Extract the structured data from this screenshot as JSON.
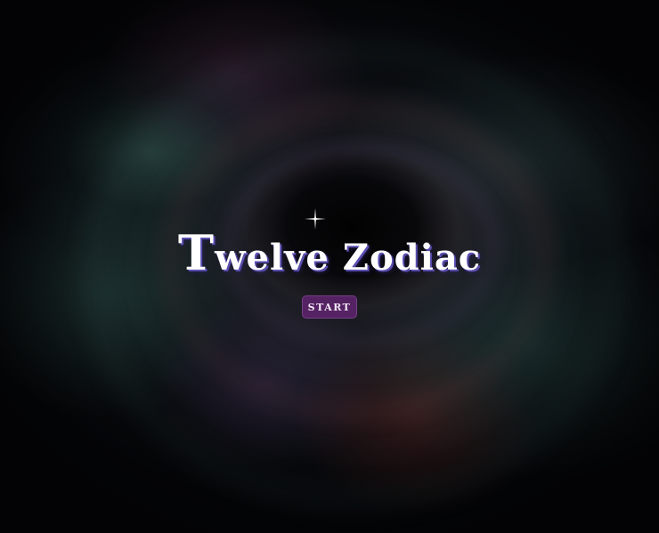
{
  "title": {
    "first_letter": "T",
    "rest": "welve Zodiac"
  },
  "start_button": {
    "label": "START"
  },
  "colors": {
    "title_text": "#ffffff",
    "title_shadow": "#5a4fb0",
    "button_background": "#5f236e",
    "button_text": "#f3e8f7",
    "page_background": "#07080c"
  },
  "background": {
    "description_icon": "nebula-background"
  }
}
